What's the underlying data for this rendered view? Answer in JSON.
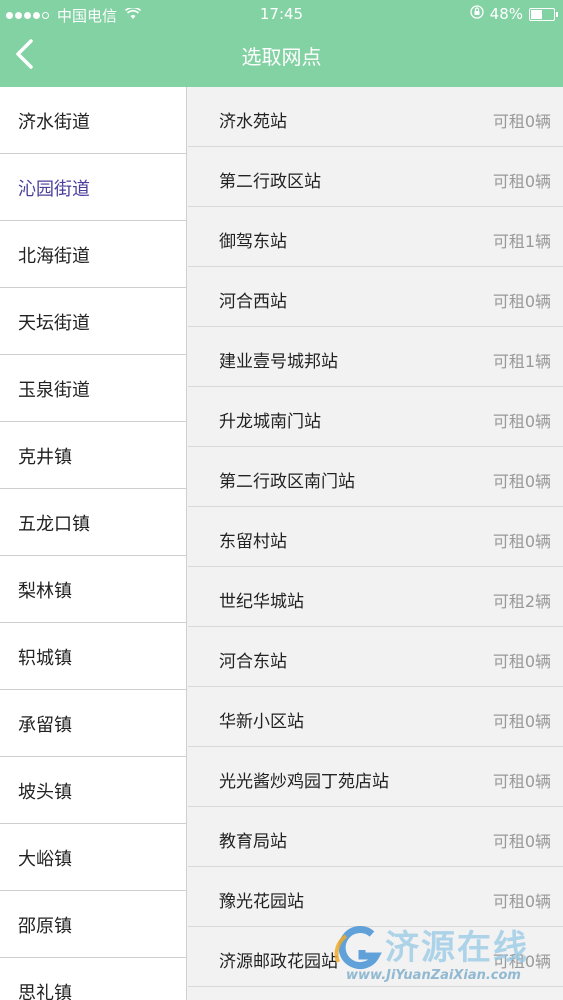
{
  "status_bar": {
    "carrier": "中国电信",
    "time": "17:45",
    "battery": "48%",
    "battery_level": 0.48
  },
  "header": {
    "title": "选取网点"
  },
  "sidebar": {
    "items": [
      {
        "label": "济水街道"
      },
      {
        "label": "沁园街道",
        "active": true
      },
      {
        "label": "北海街道"
      },
      {
        "label": "天坛街道"
      },
      {
        "label": "玉泉街道"
      },
      {
        "label": "克井镇"
      },
      {
        "label": "五龙口镇"
      },
      {
        "label": "梨林镇"
      },
      {
        "label": "轵城镇"
      },
      {
        "label": "承留镇"
      },
      {
        "label": "坡头镇"
      },
      {
        "label": "大峪镇"
      },
      {
        "label": "邵原镇"
      },
      {
        "label": "思礼镇"
      }
    ]
  },
  "stations": [
    {
      "name": "济水苑站",
      "available": "可租0辆"
    },
    {
      "name": "第二行政区站",
      "available": "可租0辆"
    },
    {
      "name": "御驾东站",
      "available": "可租1辆"
    },
    {
      "name": "河合西站",
      "available": "可租0辆"
    },
    {
      "name": "建业壹号城邦站",
      "available": "可租1辆"
    },
    {
      "name": "升龙城南门站",
      "available": "可租0辆"
    },
    {
      "name": "第二行政区南门站",
      "available": "可租0辆"
    },
    {
      "name": "东留村站",
      "available": "可租0辆"
    },
    {
      "name": "世纪华城站",
      "available": "可租2辆"
    },
    {
      "name": "河合东站",
      "available": "可租0辆"
    },
    {
      "name": "华新小区站",
      "available": "可租0辆"
    },
    {
      "name": "光光酱炒鸡园丁苑店站",
      "available": "可租0辆"
    },
    {
      "name": "教育局站",
      "available": "可租0辆"
    },
    {
      "name": "豫光花园站",
      "available": "可租0辆"
    },
    {
      "name": "济源邮政花园站",
      "available": "可租0辆"
    }
  ],
  "watermark": {
    "text": "济源在线",
    "url": "www.JiYuanZaiXian.com"
  },
  "colors": {
    "header": "#82d2a3",
    "active_item": "#4b3f9c"
  }
}
